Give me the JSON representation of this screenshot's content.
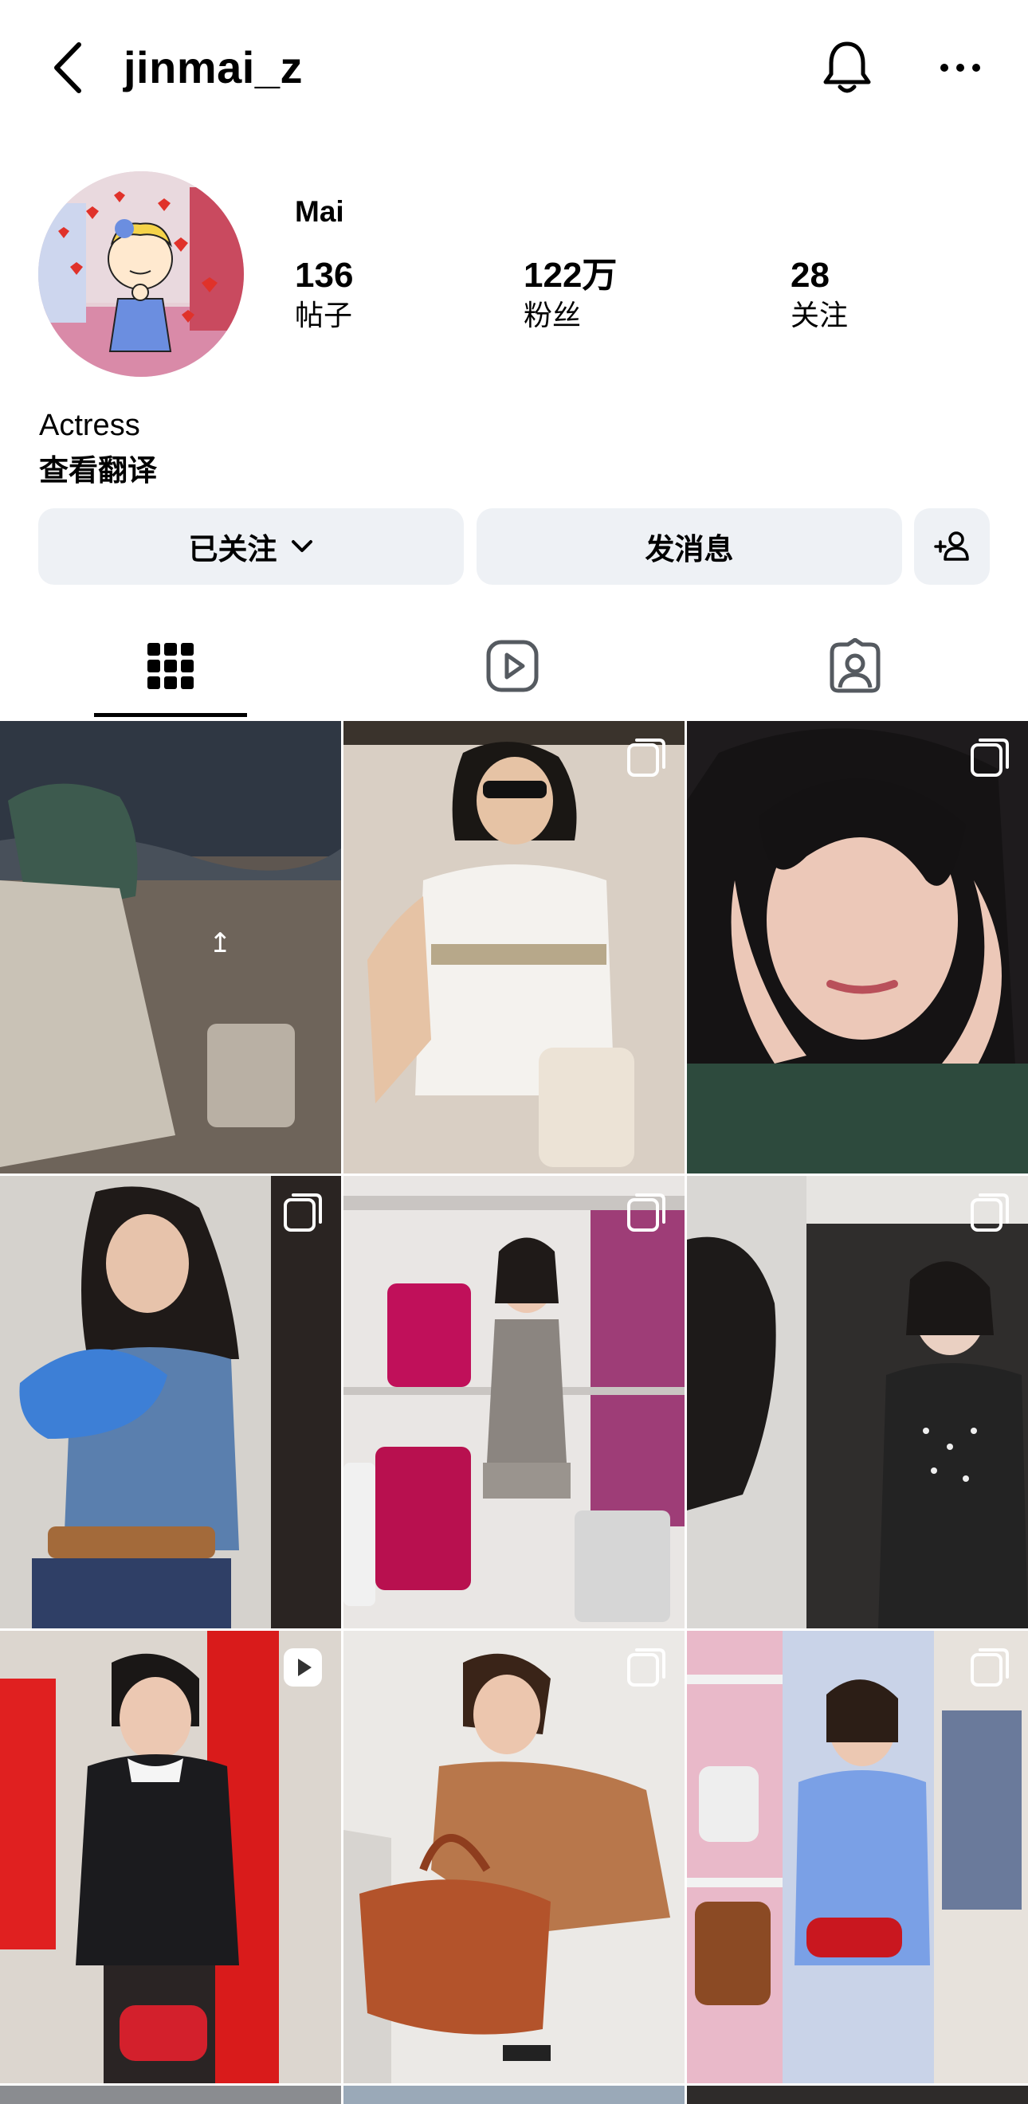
{
  "header": {
    "username": "jinmai_z"
  },
  "profile": {
    "display_name": "Mai",
    "stats": [
      {
        "value": "136",
        "label": "帖子"
      },
      {
        "value": "122万",
        "label": "粉丝"
      },
      {
        "value": "28",
        "label": "关注"
      }
    ],
    "bio": "Actress",
    "translate_label": "查看翻译"
  },
  "actions": {
    "follow_label": "已关注",
    "message_label": "发消息"
  },
  "tabs": [
    "grid-icon",
    "reels-icon",
    "tagged-icon"
  ],
  "grid": {
    "tiles": [
      {
        "kind": "photo",
        "badge": "none"
      },
      {
        "kind": "photo",
        "badge": "multi"
      },
      {
        "kind": "photo",
        "badge": "multi"
      },
      {
        "kind": "photo",
        "badge": "multi"
      },
      {
        "kind": "photo",
        "badge": "multi"
      },
      {
        "kind": "photo",
        "badge": "multi"
      },
      {
        "kind": "video",
        "badge": "reel"
      },
      {
        "kind": "photo",
        "badge": "multi"
      },
      {
        "kind": "photo",
        "badge": "multi"
      }
    ]
  },
  "colors": {
    "button_bg": "#eef1f5",
    "text": "#000000",
    "icon_gray": "#555a60"
  }
}
